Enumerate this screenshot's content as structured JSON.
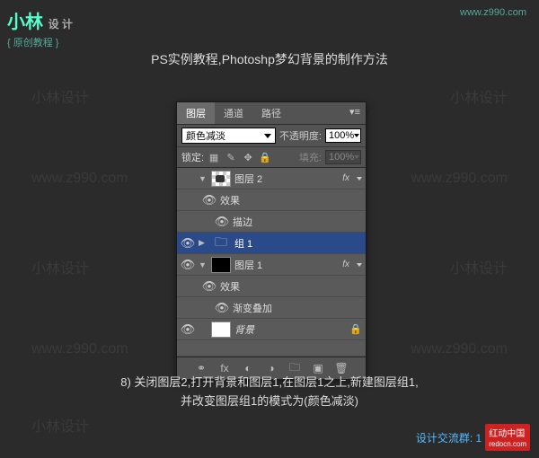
{
  "logo": {
    "main": "小林",
    "design": "设 计",
    "sub": "原创教程"
  },
  "url_top": "www.z990.com",
  "title": "PS实例教程,Photoshp梦幻背景的制作方法",
  "watermark": {
    "text1": "小林设计",
    "text2": "www.z990.com"
  },
  "panel": {
    "tabs": {
      "layers": "图层",
      "channels": "通道",
      "paths": "路径"
    },
    "blend_mode": "颜色减淡",
    "opacity_label": "不透明度:",
    "opacity_value": "100%",
    "lock_label": "锁定:",
    "fill_label": "填充:",
    "fill_value": "100%",
    "layers": {
      "layer2": "图层 2",
      "effects": "效果",
      "stroke": "描边",
      "group1": "组 1",
      "layer1": "图层 1",
      "gradient_overlay": "渐变叠加",
      "background": "背景"
    },
    "fx_label": "fx"
  },
  "caption": {
    "line1": "8) 关闭图层2,打开背景和图层1,在图层1之上,新建图层组1,",
    "line2": "并改变图层组1的模式为(颜色减淡)"
  },
  "footer": {
    "qq": "设计交流群: 1",
    "badge": "红动中国",
    "badge_url": "redocn.com"
  }
}
